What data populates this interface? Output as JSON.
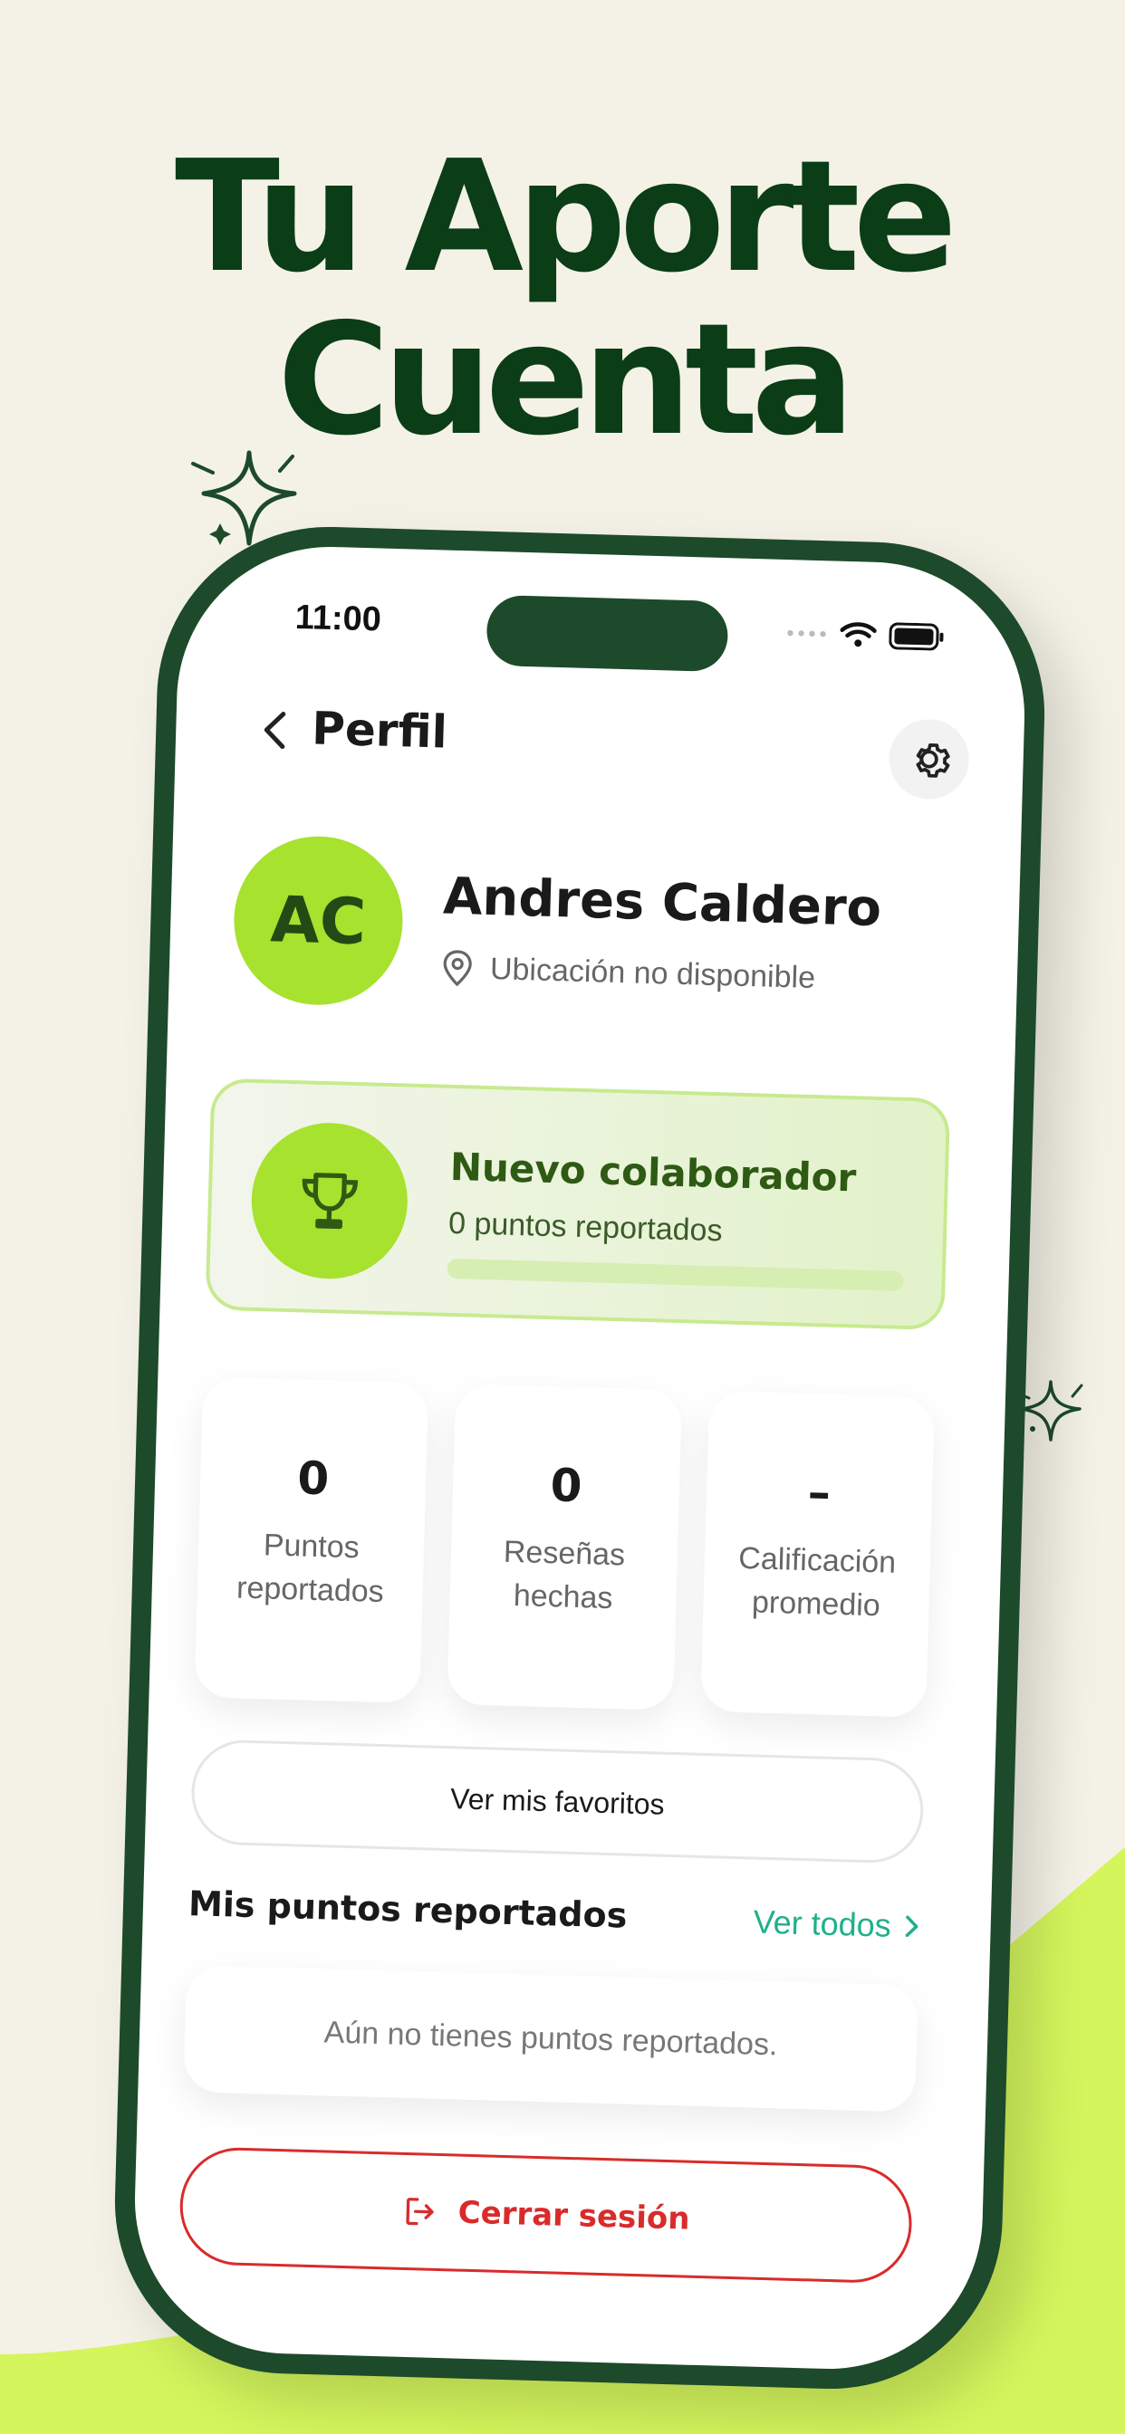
{
  "headline": {
    "line1": "Tu Aporte",
    "line2": "Cuenta"
  },
  "colors": {
    "brand_dark": "#0b3d17",
    "lime": "#a6e22e",
    "accent_teal": "#20b08a",
    "danger": "#d92b2b"
  },
  "status_bar": {
    "time": "11:00"
  },
  "nav": {
    "title": "Perfil",
    "back_icon": "chevron-left-icon",
    "settings_icon": "gear-icon"
  },
  "profile": {
    "initials": "AC",
    "name": "Andres Caldero",
    "location": "Ubicación no disponible"
  },
  "badge": {
    "title": "Nuevo colaborador",
    "subtitle": "0 puntos reportados",
    "progress": 0
  },
  "stats": [
    {
      "value": "0",
      "label": "Puntos reportados"
    },
    {
      "value": "0",
      "label": "Reseñas hechas"
    },
    {
      "value": "–",
      "label": "Calificación promedio"
    }
  ],
  "favorites_button": "Ver mis favoritos",
  "reported_section": {
    "title": "Mis puntos reportados",
    "link": "Ver todos",
    "empty_text": "Aún no tienes puntos reportados."
  },
  "logout_button": "Cerrar sesión"
}
